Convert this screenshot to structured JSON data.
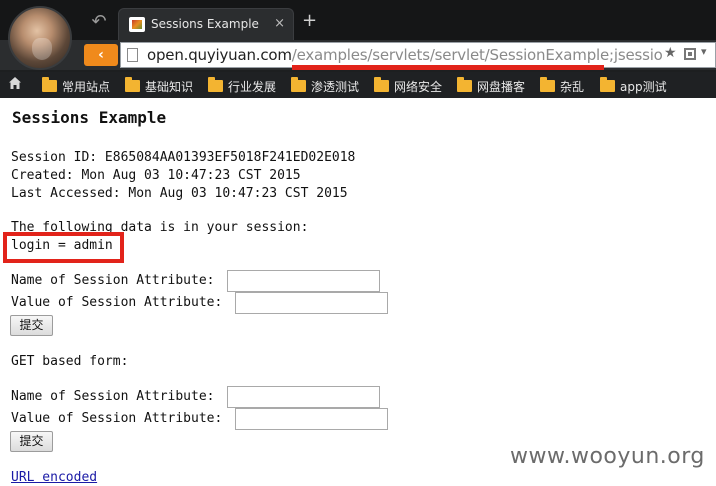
{
  "browser": {
    "tab_title": "Sessions Example",
    "tab_close": "×",
    "new_tab": "+",
    "back": "↶",
    "forward": "‹",
    "url_host": "open.quyiyuan.com",
    "url_path": "/examples/servlets/servlet/SessionExample;jsession",
    "url_star": "★",
    "url_dropdown": "▾",
    "bookmarks": [
      {
        "label": "常用站点"
      },
      {
        "label": "基础知识"
      },
      {
        "label": "行业发展"
      },
      {
        "label": "渗透测试"
      },
      {
        "label": "网络安全"
      },
      {
        "label": "网盘播客"
      },
      {
        "label": "杂乱"
      },
      {
        "label": "app测试"
      }
    ],
    "highlight_color": "#e2231a",
    "forward_color": "#f08a1c"
  },
  "page": {
    "heading": "Sessions Example",
    "session_id": "Session ID: E865084AA01393EF5018F241ED02E018",
    "created": "Created: Mon Aug 03 10:47:23 CST 2015",
    "last_accessed": "Last Accessed: Mon Aug 03 10:47:23 CST 2015",
    "session_data_intro": "The following data is in your session:",
    "session_entry": "login = admin",
    "form1": {
      "name_label": "Name of Session Attribute:",
      "value_label": "Value of Session Attribute:",
      "name_value": "",
      "value_value": "",
      "submit_label": "提交"
    },
    "get_form_label": "GET based form:",
    "form2": {
      "name_label": "Name of Session Attribute:",
      "value_label": "Value of Session Attribute:",
      "name_value": "",
      "value_value": "",
      "submit_label": "提交"
    },
    "url_encoded_link": "URL encoded",
    "watermark": "www.wooyun.org"
  }
}
